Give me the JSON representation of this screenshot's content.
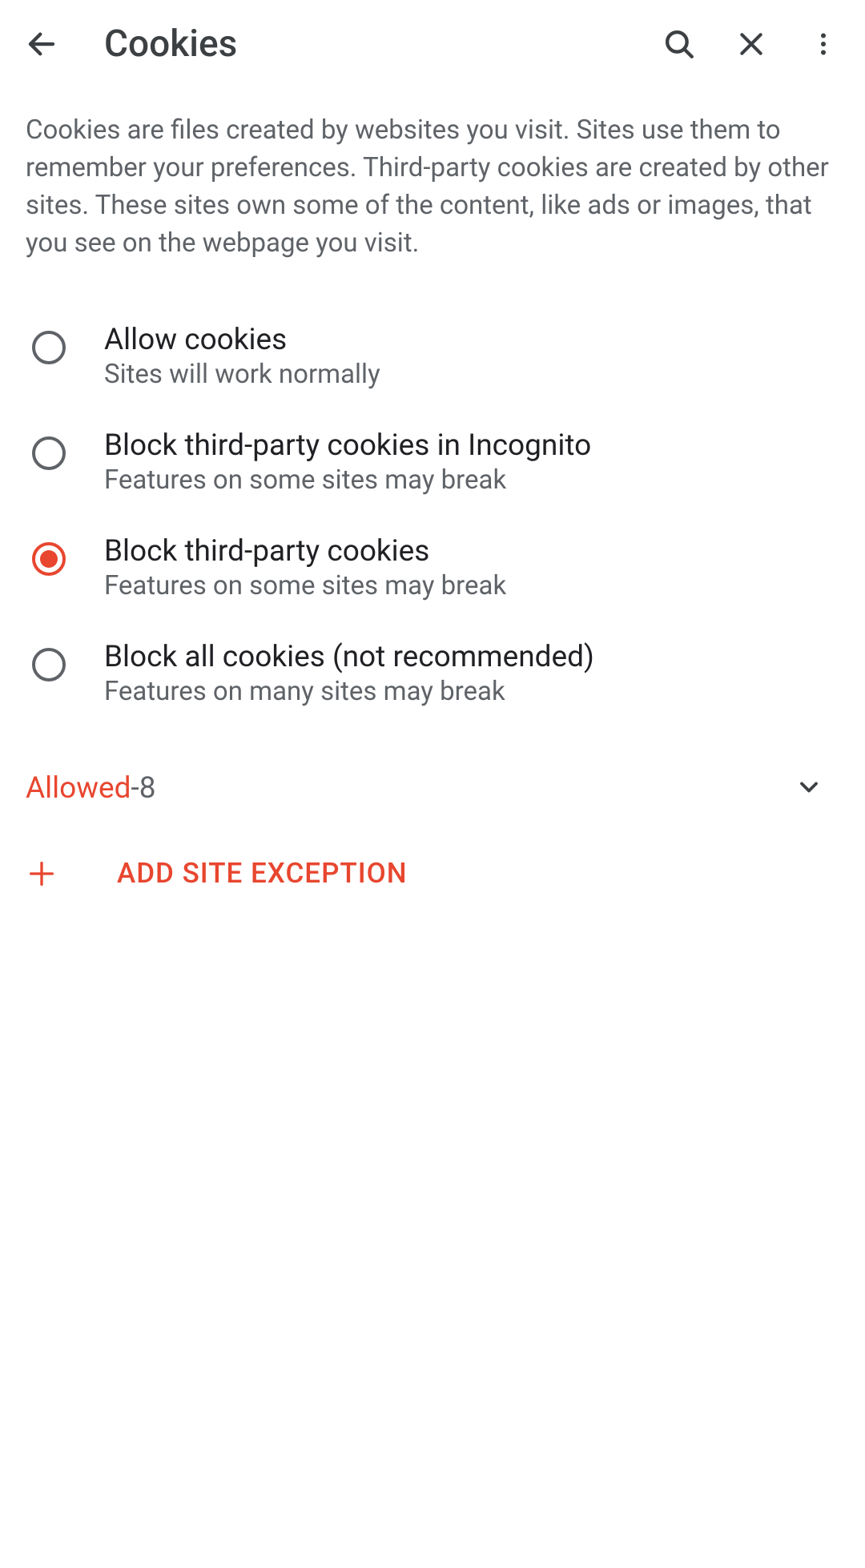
{
  "header": {
    "title": "Cookies"
  },
  "description": "Cookies are files created by websites you visit. Sites use them to remember your preferences. Third-party cookies are created by other sites. These sites own some of the content, like ads or images, that you see on the webpage you visit.",
  "options": [
    {
      "title": "Allow cookies",
      "subtitle": "Sites will work normally",
      "selected": false
    },
    {
      "title": "Block third-party cookies in Incognito",
      "subtitle": "Features on some sites may break",
      "selected": false
    },
    {
      "title": "Block third-party cookies",
      "subtitle": "Features on some sites may break",
      "selected": true
    },
    {
      "title": "Block all cookies (not recommended)",
      "subtitle": "Features on many sites may break",
      "selected": false
    }
  ],
  "allowed": {
    "label": "Allowed",
    "separator": " - ",
    "count": "8"
  },
  "addException": {
    "label": "ADD SITE EXCEPTION"
  },
  "colors": {
    "accent": "#e8462f",
    "textPrimary": "#202124",
    "textSecondary": "#5f6368"
  }
}
